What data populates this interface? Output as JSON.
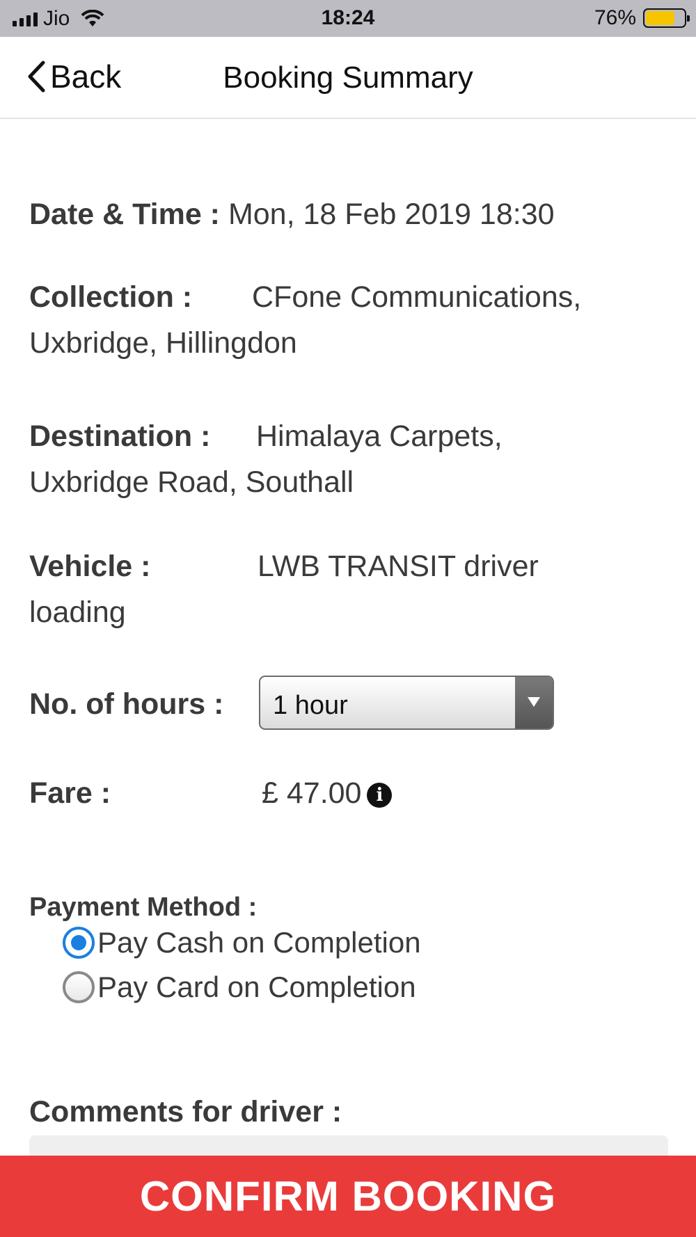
{
  "status_bar": {
    "carrier": "Jio",
    "time": "18:24",
    "battery_percent": "76%",
    "battery_level": 0.76,
    "battery_color": "#f7c500"
  },
  "nav": {
    "back_label": "Back",
    "title": "Booking Summary"
  },
  "summary": {
    "datetime_label": "Date & Time :",
    "datetime_value": "Mon, 18 Feb 2019 18:30",
    "collection_label": "Collection :",
    "collection_line1": "CFone Communications,",
    "collection_line2": "Uxbridge, Hillingdon",
    "destination_label": "Destination :",
    "destination_line1": "Himalaya Carpets,",
    "destination_line2": "Uxbridge Road, Southall",
    "vehicle_label": "Vehicle :",
    "vehicle_line1": "LWB TRANSIT driver",
    "vehicle_line2": "loading",
    "hours_label": "No. of hours :",
    "hours_selected": "1 hour",
    "fare_label": "Fare :",
    "fare_value": "£ 47.00",
    "info_icon_glyph": "i"
  },
  "payment": {
    "label": "Payment Method :",
    "options": [
      {
        "label": "Pay Cash on Completion",
        "selected": true
      },
      {
        "label": "Pay Card on Completion",
        "selected": false
      }
    ],
    "accent_color": "#1a7fe0"
  },
  "comments": {
    "label": "Comments for driver :",
    "placeholder": "Comments for driver",
    "value": ""
  },
  "confirm": {
    "label": "CONFIRM BOOKING",
    "color": "#ea3b3b"
  }
}
